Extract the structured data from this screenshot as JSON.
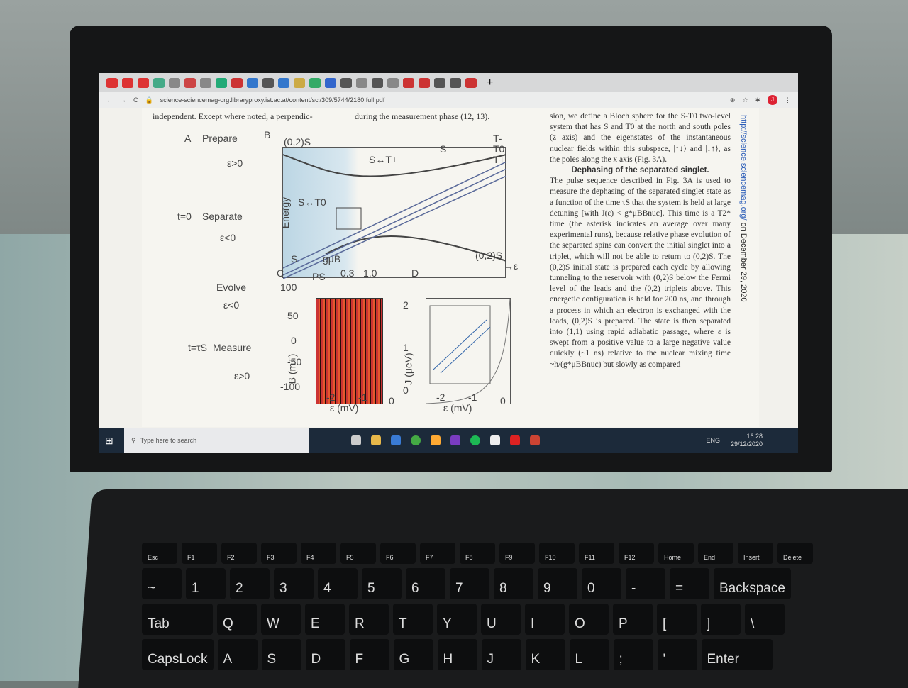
{
  "browser": {
    "url": "science-sciencemag-org.libraryproxy.ist.ac.at/content/sci/309/5744/2180.full.pdf",
    "tab_colors": [
      "#d33",
      "#d33",
      "#d33",
      "#4a8",
      "#888",
      "#c44",
      "#888",
      "#2a7",
      "#c33",
      "#37c",
      "#555",
      "#37c",
      "#ca4",
      "#3a6",
      "#36c",
      "#555",
      "#888",
      "#555",
      "#888",
      "#c33",
      "#c33",
      "#555",
      "#555",
      "#c33"
    ],
    "new_tab": "+",
    "avatar": "J"
  },
  "paper": {
    "col1_top": "independent. Except where noted, a perpendic-",
    "col2_top": "during the measurement phase (12, 13).",
    "col3": "sion, we define a Bloch sphere for the S-T0 two-level system that has S and T0 at the north and south poles (z axis) and the eigenstates of the instantaneous nuclear fields within this subspace, |↑↓⟩ and |↓↑⟩, as the poles along the x axis (Fig. 3A).",
    "col3_heading": "Dephasing of the separated singlet.",
    "col3_body": "The pulse sequence described in Fig. 3A is used to measure the dephasing of the separated singlet state as a function of the time τS that the system is held at large detuning [with J(ε) < g*μBBnuc]. This time is a T2* time (the asterisk indicates an average over many experimental runs), because relative phase evolution of the separated spins can convert the initial singlet into a triplet, which will not be able to return to (0,2)S. The (0,2)S initial state is prepared each cycle by allowing tunneling to the reservoir with (0,2)S below the Fermi level of the leads and the (0,2) triplets above. This energetic configuration is held for 200 ns, and through a process in which an electron is exchanged with the leads, (0,2)S is prepared. The state is then separated into (1,1) using rapid adiabatic passage, where ε is swept from a positive value to a large negative value quickly (~1 ns) relative to the nuclear mixing time ~ħ/(g*μBBnuc) but slowly as compared",
    "side_url": "http://science.sciencemag.org/",
    "side_date": " on December 29, 2020"
  },
  "figure": {
    "labels_A": [
      "A",
      "Prepare",
      "ε>0",
      "t=0",
      "Separate",
      "ε<0",
      "Evolve",
      "ε<0",
      "t=τS",
      "Measure",
      "ε>0"
    ],
    "labels_B": [
      "B",
      "(0,2)S",
      "Energy",
      "S↔T+",
      "S↔T0",
      "S",
      "gμB",
      "(0,2)S",
      "→ε",
      "T-",
      "T0",
      "T+",
      "S"
    ],
    "labels_C": [
      "C",
      "PS",
      "0.3",
      "1.0",
      "100",
      "50",
      "0",
      "-50",
      "-100",
      "B (mT)",
      "-2",
      "-1",
      "0",
      "ε (mV)"
    ],
    "labels_D": [
      "D",
      "2",
      "1",
      "0",
      "J (μeV)",
      "-2",
      "-1",
      "0",
      "ε (mV)"
    ]
  },
  "taskbar": {
    "search_placeholder": "Type here to search",
    "lang": "ENG",
    "time": "16:28",
    "date": "29/12/2020"
  },
  "keyboard": {
    "fn_row": [
      "Esc",
      "F1",
      "F2",
      "F3",
      "F4",
      "F5",
      "F6",
      "F7",
      "F8",
      "F9",
      "F10",
      "F11",
      "F12",
      "Home",
      "End",
      "Insert",
      "Delete"
    ],
    "num_row": [
      "~",
      "1",
      "2",
      "3",
      "4",
      "5",
      "6",
      "7",
      "8",
      "9",
      "0",
      "-",
      "=",
      "Backspace"
    ],
    "q_row": [
      "Tab",
      "Q",
      "W",
      "E",
      "R",
      "T",
      "Y",
      "U",
      "I",
      "O",
      "P",
      "[",
      "]",
      "\\"
    ],
    "a_row": [
      "CapsLock",
      "A",
      "S",
      "D",
      "F",
      "G",
      "H",
      "J",
      "K",
      "L",
      ";",
      "'",
      "Enter"
    ]
  }
}
